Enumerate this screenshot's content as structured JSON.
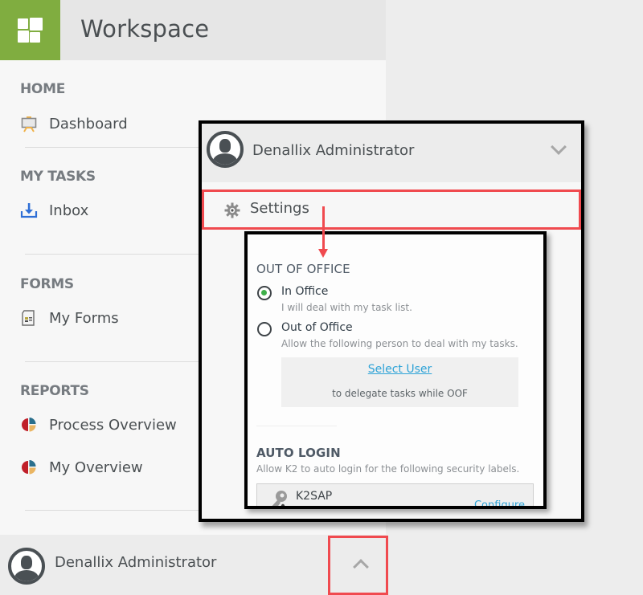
{
  "app": {
    "title": "Workspace",
    "logo_icon": "apps-grid-icon",
    "brand_color": "#80ad40"
  },
  "sidebar": {
    "sections": [
      {
        "heading": "HOME",
        "items": [
          {
            "label": "Dashboard",
            "icon": "dashboard-easel-icon"
          }
        ]
      },
      {
        "heading": "MY TASKS",
        "items": [
          {
            "label": "Inbox",
            "icon": "inbox-download-icon"
          }
        ]
      },
      {
        "heading": "FORMS",
        "items": [
          {
            "label": "My Forms",
            "icon": "form-document-icon"
          }
        ]
      },
      {
        "heading": "REPORTS",
        "items": [
          {
            "label": "Process Overview",
            "icon": "pie-chart-icon"
          },
          {
            "label": "My Overview",
            "icon": "pie-chart-icon"
          }
        ]
      }
    ],
    "footer": {
      "user_name": "Denallix Administrator",
      "toggle_icon": "chevron-up-icon"
    }
  },
  "user_menu": {
    "user_name": "Denallix Administrator",
    "toggle_icon": "chevron-down-icon",
    "settings_label": "Settings",
    "settings_icon": "gear-icon"
  },
  "settings_panel": {
    "out_of_office": {
      "heading": "OUT OF OFFICE",
      "options": [
        {
          "label": "In Office",
          "description": "I will deal with my task list.",
          "selected": true
        },
        {
          "label": "Out of Office",
          "description": "Allow the following person to deal with my tasks.",
          "selected": false
        }
      ],
      "select_user_link": "Select User",
      "delegate_text": "to delegate tasks while OOF"
    },
    "auto_login": {
      "heading": "AUTO LOGIN",
      "description": "Allow K2 to auto login for the following security labels.",
      "labels": [
        {
          "name": "K2SAP",
          "action": "Configure",
          "icon": "key-network-icon"
        }
      ]
    }
  },
  "annotation": {
    "highlight_color": "#f04a4f",
    "frame_color": "#000000"
  }
}
